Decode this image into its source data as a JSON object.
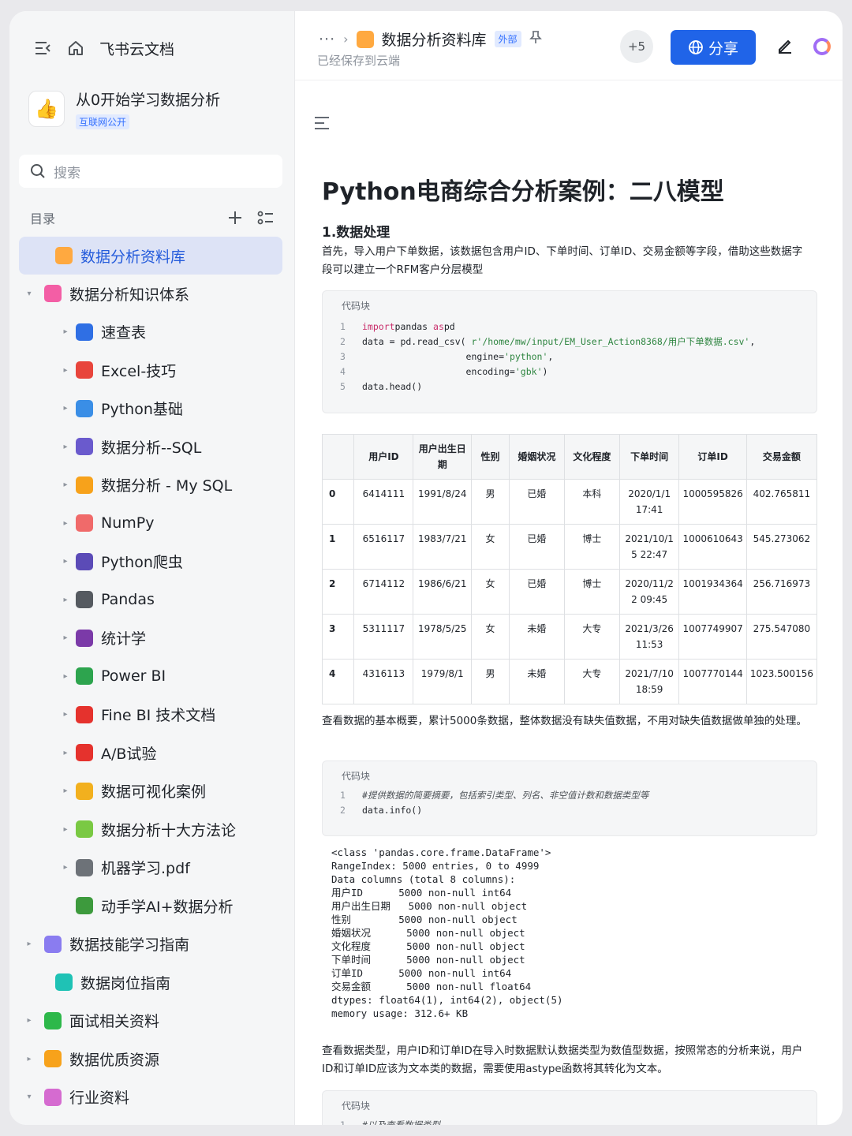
{
  "sidebar": {
    "brand": "飞书云文档",
    "workspace": {
      "title": "从0开始学习数据分析",
      "badge": "互联网公开"
    },
    "search_placeholder": "搜索",
    "toc_label": "目录",
    "items": [
      {
        "label": "数据分析资料库",
        "icon": "folder-icon",
        "color": "#ffa940",
        "level": 0,
        "caret": "",
        "active": true
      },
      {
        "label": "数据分析知识体系",
        "icon": "doc-icon",
        "color": "#f35ea5",
        "level": 0,
        "caret": "▾"
      },
      {
        "label": "速查表",
        "icon": "magnifier-icon",
        "color": "#2f6fe4",
        "level": 1,
        "caret": "▸"
      },
      {
        "label": "Excel-技巧",
        "icon": "hundred-icon",
        "color": "#e8453c",
        "level": 1,
        "caret": "▸"
      },
      {
        "label": "Python基础",
        "icon": "laptop-icon",
        "color": "#3a8ee6",
        "level": 1,
        "caret": "▸"
      },
      {
        "label": "数据分析--SQL",
        "icon": "bar-chart-icon",
        "color": "#6a5acd",
        "level": 1,
        "caret": "▸"
      },
      {
        "label": "数据分析 - My SQL",
        "icon": "rainbow-icon",
        "color": "#f7a21b",
        "level": 1,
        "caret": "▸"
      },
      {
        "label": "NumPy",
        "icon": "memo-icon",
        "color": "#f06a6a",
        "level": 1,
        "caret": "▸"
      },
      {
        "label": "Python爬虫",
        "icon": "ant-icon",
        "color": "#5b4bb7",
        "level": 1,
        "caret": "▸"
      },
      {
        "label": "Pandas",
        "icon": "panda-icon",
        "color": "#555a60",
        "level": 1,
        "caret": "▸"
      },
      {
        "label": "统计学",
        "icon": "floppy-icon",
        "color": "#7b3aa8",
        "level": 1,
        "caret": "▸"
      },
      {
        "label": "Power BI",
        "icon": "recycle-icon",
        "color": "#2da44e",
        "level": 1,
        "caret": "▸"
      },
      {
        "label": "Fine BI 技术文档",
        "icon": "pushpin-icon",
        "color": "#e5322d",
        "level": 1,
        "caret": "▸"
      },
      {
        "label": "A/B试验",
        "icon": "ab-icon",
        "color": "#e5322d",
        "level": 1,
        "caret": "▸"
      },
      {
        "label": "数据可视化案例",
        "icon": "medal-icon",
        "color": "#f2b01e",
        "level": 1,
        "caret": "▸"
      },
      {
        "label": "数据分析十大方法论",
        "icon": "puzzle-icon",
        "color": "#7ac943",
        "level": 1,
        "caret": "▸"
      },
      {
        "label": "机器学习.pdf",
        "icon": "robot-icon",
        "color": "#6d7278",
        "level": 1,
        "caret": "▸"
      },
      {
        "label": "动手学AI+数据分析",
        "icon": "battery-icon",
        "color": "#3d9a3d",
        "level": 1,
        "caret": ""
      },
      {
        "label": "数据技能学习指南",
        "icon": "doc-icon",
        "color": "#8a7cf0",
        "level": 0,
        "caret": "▸"
      },
      {
        "label": "数据岗位指南",
        "icon": "lightning-icon",
        "color": "#1fc2b5",
        "level": 0,
        "caret": ""
      },
      {
        "label": "面试相关资料",
        "icon": "clock-icon",
        "color": "#2db84a",
        "level": 0,
        "caret": "▸"
      },
      {
        "label": "数据优质资源",
        "icon": "thumbs-up-icon",
        "color": "#f7a21b",
        "level": 0,
        "caret": "▸"
      },
      {
        "label": "行业资料",
        "icon": "ghost-icon",
        "color": "#d56bd0",
        "level": 0,
        "caret": "▾"
      }
    ]
  },
  "header": {
    "dots": "···",
    "doc_name": "数据分析资料库",
    "ext_badge": "外部",
    "saved": "已经保存到云端",
    "collaborators": "+5",
    "share_label": "分享"
  },
  "doc": {
    "title": "Python电商综合分析案例：二八模型",
    "h1": "1.数据处理",
    "para1": "首先，导入用户下单数据，该数据包含用户ID、下单时间、订单ID、交易金额等字段，借助这些数据字段可以建立一个RFM客户分层模型",
    "code_label": "代码块",
    "code1": [
      {
        "n": "1",
        "parts": [
          [
            "kw",
            "import"
          ],
          [
            "",
            "pandas "
          ],
          [
            "kw",
            "as"
          ],
          [
            "",
            "pd"
          ]
        ]
      },
      {
        "n": "2",
        "parts": [
          [
            "",
            "data = pd.read_csv( "
          ],
          [
            "str",
            "r'/home/mw/input/EM_User_Action8368/用户下单数据.csv'"
          ],
          [
            "",
            ","
          ]
        ]
      },
      {
        "n": "3",
        "parts": [
          [
            "",
            "                   engine="
          ],
          [
            "str",
            "'python'"
          ],
          [
            "",
            ","
          ]
        ]
      },
      {
        "n": "4",
        "parts": [
          [
            "",
            "                   encoding="
          ],
          [
            "str",
            "'gbk'"
          ],
          [
            "",
            ")"
          ]
        ]
      },
      {
        "n": "5",
        "parts": [
          [
            "",
            "data.head()"
          ]
        ]
      }
    ],
    "table": {
      "headers": [
        "",
        "用户ID",
        "用户出生日期",
        "性别",
        "婚姻状况",
        "文化程度",
        "下单时间",
        "订单ID",
        "交易金额"
      ],
      "rows": [
        [
          "0",
          "6414111",
          "1991/8/24",
          "男",
          "已婚",
          "本科",
          "2020/1/1 17:41",
          "1000595826",
          "402.765811"
        ],
        [
          "1",
          "6516117",
          "1983/7/21",
          "女",
          "已婚",
          "博士",
          "2021/10/1 5 22:47",
          "1000610643",
          "545.273062"
        ],
        [
          "2",
          "6714112",
          "1986/6/21",
          "女",
          "已婚",
          "博士",
          "2020/11/2 2 09:45",
          "1001934364",
          "256.716973"
        ],
        [
          "3",
          "5311117",
          "1978/5/25",
          "女",
          "未婚",
          "大专",
          "2021/3/26 11:53",
          "1007749907",
          "275.547080"
        ],
        [
          "4",
          "4316113",
          "1979/8/1",
          "男",
          "未婚",
          "大专",
          "2021/7/10 18:59",
          "1007770144",
          "1023.500156"
        ]
      ]
    },
    "para2": "查看数据的基本概要，累计5000条数据，整体数据没有缺失值数据，不用对缺失值数据做单独的处理。",
    "code2": [
      {
        "n": "1",
        "parts": [
          [
            "cm",
            "#提供数据的简要摘要，包括索引类型、列名、非空值计数和数据类型等"
          ]
        ]
      },
      {
        "n": "2",
        "parts": [
          [
            "",
            "data.info()"
          ]
        ]
      }
    ],
    "output": "<class 'pandas.core.frame.DataFrame'>\nRangeIndex: 5000 entries, 0 to 4999\nData columns (total 8 columns):\n用户ID      5000 non-null int64\n用户出生日期   5000 non-null object\n性别        5000 non-null object\n婚姻状况      5000 non-null object\n文化程度      5000 non-null object\n下单时间      5000 non-null object\n订单ID      5000 non-null int64\n交易金额      5000 non-null float64\ndtypes: float64(1), int64(2), object(5)\nmemory usage: 312.6+ KB",
    "para3": "查看数据类型，用户ID和订单ID在导入时数据默认数据类型为数值型数据，按照常态的分析来说，用户ID和订单ID应该为文本类的数据，需要使用astype函数将其转化为文本。",
    "code3": [
      {
        "n": "1",
        "parts": [
          [
            "cm",
            "#以及查看数据类型"
          ]
        ]
      }
    ]
  }
}
